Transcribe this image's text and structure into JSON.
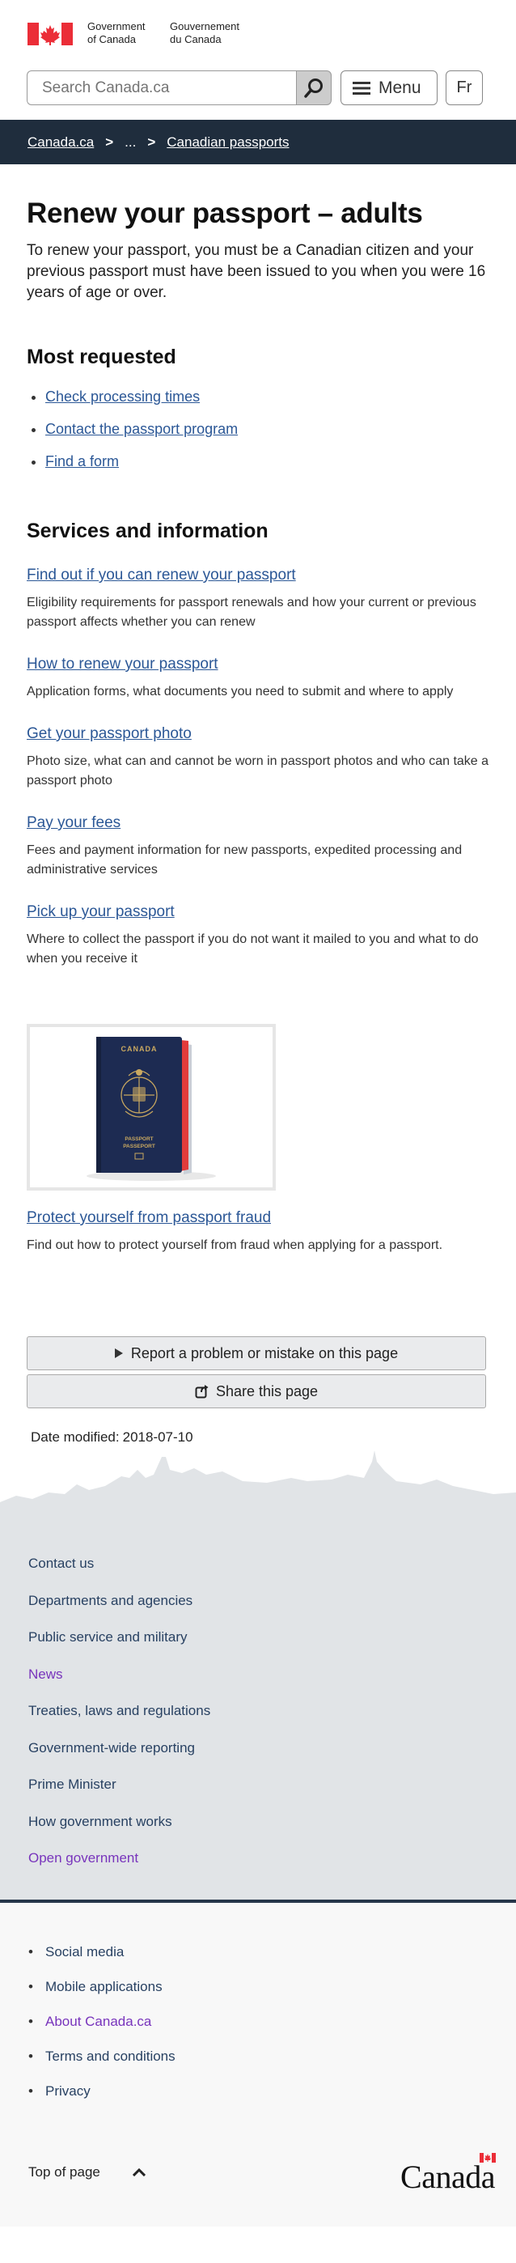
{
  "header": {
    "signature_en_1": "Government",
    "signature_en_2": "of Canada",
    "signature_fr_1": "Gouvernement",
    "signature_fr_2": "du Canada",
    "search_placeholder": "Search Canada.ca",
    "search_icon": "magnifier-icon",
    "menu_label": "Menu",
    "lang_toggle": "Fr"
  },
  "breadcrumb": [
    "Canada.ca",
    "...",
    "Canadian passports"
  ],
  "page": {
    "title": "Renew your passport – adults",
    "intro": "To renew your passport, you must be a Canadian citizen and your previous passport must have been issued to you when you were 16 years of age or over."
  },
  "most_requested": {
    "heading": "Most requested",
    "links": [
      "Check processing times",
      "Contact the passport program",
      "Find a form"
    ]
  },
  "services": {
    "heading": "Services and information",
    "items": [
      {
        "title": "Find out if you can renew your passport",
        "desc": "Eligibility requirements for passport renewals and how your current or previous passport affects whether you can renew"
      },
      {
        "title": "How to renew your passport",
        "desc": "Application forms, what documents you need to submit and where to apply"
      },
      {
        "title": "Get your passport photo",
        "desc": "Photo size, what can and cannot be worn in passport photos and who can take a passport photo"
      },
      {
        "title": "Pay your fees",
        "desc": "Fees and payment information for new passports, expedited processing and administrative services"
      },
      {
        "title": "Pick up your passport",
        "desc": "Where to collect the passport if you do not want it mailed to you and what to do when you receive it"
      }
    ]
  },
  "promo": {
    "image_text_top": "CANADA",
    "image_text_bottom_1": "PASSPORT",
    "image_text_bottom_2": "PASSEPORT",
    "title": "Protect yourself from passport fraud",
    "desc": "Find out how to protect yourself from fraud when applying for a passport."
  },
  "page_details": {
    "report_label": "Report a problem or mistake on this page",
    "share_label": "Share this page",
    "date_label": "Date modified:",
    "date_value": "2018-07-10"
  },
  "footer_main": [
    {
      "label": "Contact us",
      "visited": false
    },
    {
      "label": "Departments and agencies",
      "visited": false
    },
    {
      "label": "Public service and military",
      "visited": false
    },
    {
      "label": "News",
      "visited": true
    },
    {
      "label": "Treaties, laws and regulations",
      "visited": false
    },
    {
      "label": "Government-wide reporting",
      "visited": false
    },
    {
      "label": "Prime Minister",
      "visited": false
    },
    {
      "label": "How government works",
      "visited": false
    },
    {
      "label": "Open government",
      "visited": true
    }
  ],
  "footer_sub": [
    {
      "label": "Social media",
      "visited": false
    },
    {
      "label": "Mobile applications",
      "visited": false
    },
    {
      "label": "About Canada.ca",
      "visited": true
    },
    {
      "label": "Terms and conditions",
      "visited": false
    },
    {
      "label": "Privacy",
      "visited": false
    }
  ],
  "footer_bottom": {
    "top_of_page": "Top of page",
    "wordmark": "Canada"
  },
  "colors": {
    "link": "#2b5796",
    "visited": "#7834bc",
    "breadcrumb_bg": "#1f2d3d",
    "flag_red": "#eb2d37",
    "footer_bg": "#e1e4e7"
  }
}
